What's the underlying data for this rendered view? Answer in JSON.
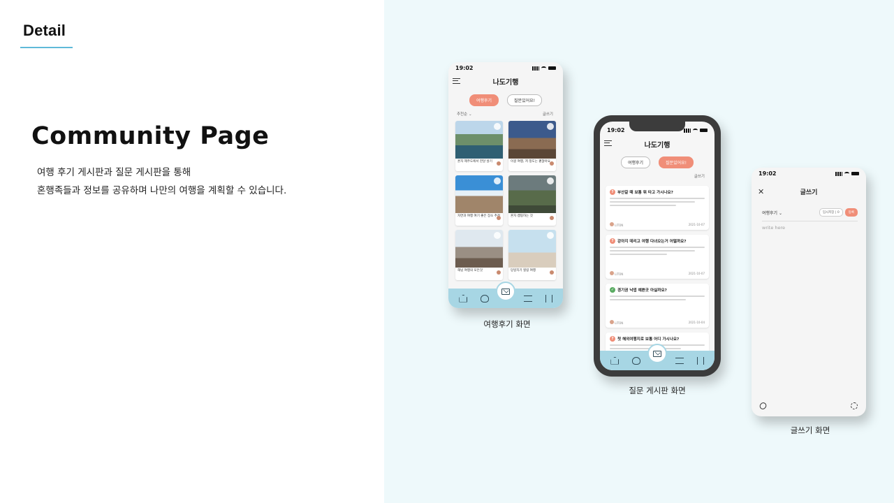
{
  "header": {
    "section_title": "Detail"
  },
  "intro": {
    "heading": "Community Page",
    "line1": "여행 후기 게시판과 질문 게시판을 통해",
    "line2": "혼행족들과 정보를 공유하며 나만의 여행을 계획할 수 있습니다."
  },
  "accent_color": "#f08e78",
  "tabbar_color": "#a7d6e4",
  "phone_review": {
    "time": "19:02",
    "app_title": "나도기행",
    "tab_review": "여행후기",
    "tab_question": "질문있어요!",
    "sort_label": "추천순",
    "write_link": "글쓰기",
    "cards": [
      {
        "caption": "혼자 제주도에서 한달 살기"
      },
      {
        "caption": "이걸 여행, 저 정도는 괜찮아요"
      },
      {
        "caption": "자연과 여행 여기 좋은 장소 추천"
      },
      {
        "caption": "혼자 캠핑하는 것"
      },
      {
        "caption": "해님 여행의 모든것"
      },
      {
        "caption": "당일치기 힐링 여행"
      }
    ],
    "caption": "여행후기 화면"
  },
  "phone_question": {
    "time": "19:02",
    "app_title": "나도기행",
    "tab_review": "여행후기",
    "tab_question": "질문있어요!",
    "write_link": "글쓰기",
    "questions": [
      {
        "title": "부산갈 때 보통 뭐 타고 가시나요?",
        "user": "LITON",
        "date": "2021-10-07"
      },
      {
        "title": "강아지 데리고 여행 다녀오는거 어떨까요?",
        "user": "LITON",
        "date": "2021-10-07"
      },
      {
        "title": "경기권 낙엽 예쁜곳 아실까요?",
        "user": "LITON",
        "date": "2021-10-04"
      },
      {
        "title": "첫 해외여행지로 보통 어디 가시나요?",
        "user": "",
        "date": ""
      }
    ],
    "caption": "질문 게시판 화면"
  },
  "phone_write": {
    "time": "19:02",
    "title": "글쓰기",
    "category": "여행후기",
    "temp_save": "임시저장",
    "temp_count": "0",
    "submit": "등록",
    "placeholder": "write here",
    "caption": "글쓰기 화면"
  },
  "icons": [
    "menu-icon",
    "heart-icon",
    "home-icon",
    "hand-icon",
    "mail-icon",
    "list-icon",
    "book-icon",
    "close-icon",
    "clip-icon",
    "gear-icon",
    "chevron-down-icon"
  ]
}
